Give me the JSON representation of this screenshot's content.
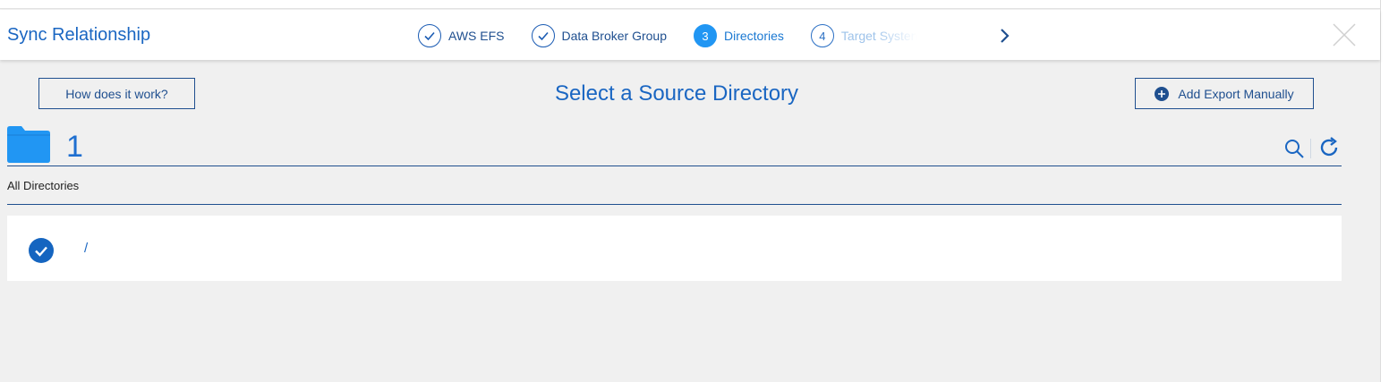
{
  "header": {
    "title": "Sync Relationship",
    "steps": [
      {
        "label": "AWS EFS",
        "state": "done"
      },
      {
        "label": "Data Broker Group",
        "state": "done"
      },
      {
        "number": "3",
        "label": "Directories",
        "state": "active"
      },
      {
        "number": "4",
        "label": "Target System",
        "state": "pending"
      }
    ],
    "next_icon": "chevron-right-icon",
    "close_icon": "close-icon"
  },
  "toolbar": {
    "how_label": "How does it work?",
    "heading": "Select a Source Directory",
    "add_export_label": "Add Export Manually"
  },
  "directory_panel": {
    "count": "1",
    "breadcrumb": "All Directories",
    "items": [
      {
        "name": "/",
        "selected": true
      }
    ]
  },
  "colors": {
    "accent": "#1a66c2",
    "active_step": "#2196f3",
    "folder": "#2196f3",
    "background": "#f0f0f0"
  }
}
